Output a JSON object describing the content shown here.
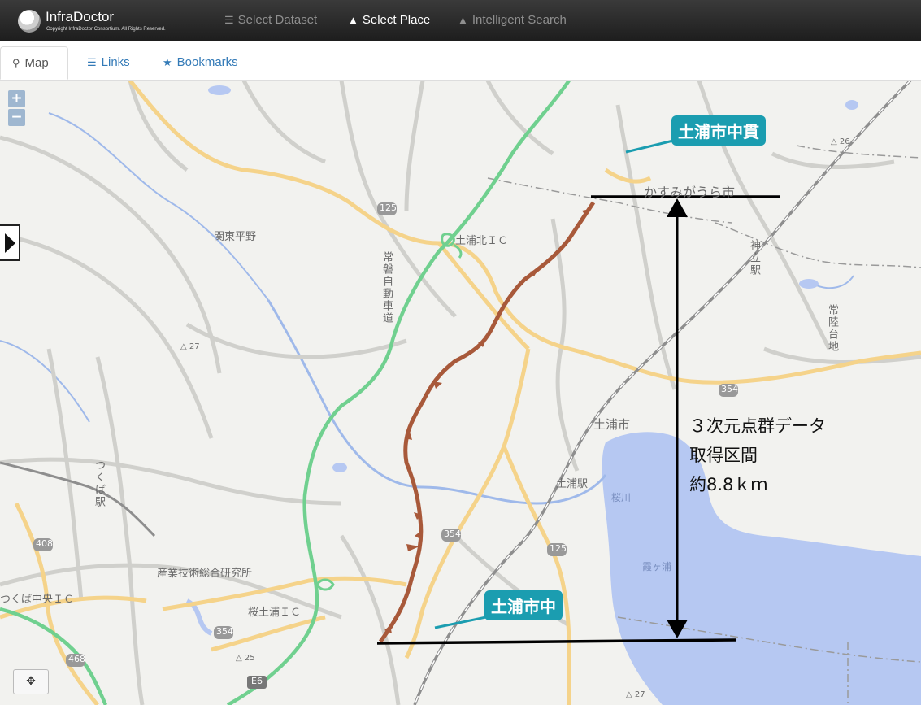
{
  "app": {
    "name": "InfraDoctor",
    "copyright": "Copyright InfraDoctor Consortium. All Rights Reserved."
  },
  "nav": [
    {
      "label": "Select Dataset",
      "icon": "table-icon",
      "active": false
    },
    {
      "label": "Select Place",
      "icon": "road-icon",
      "active": true
    },
    {
      "label": "Intelligent Search",
      "icon": "road-icon",
      "active": false
    }
  ],
  "tabs": [
    {
      "label": "Map",
      "icon": "map-marker-icon",
      "active": true
    },
    {
      "label": "Links",
      "icon": "list-icon",
      "active": false
    },
    {
      "label": "Bookmarks",
      "icon": "star-icon",
      "active": false
    }
  ],
  "map_controls": {
    "zoom_in": "+",
    "zoom_out": "−"
  },
  "map_labels": {
    "kasumigaura": "かすみがうら市",
    "kanto_heiya": "関東平野",
    "tsuchiura_kita_ic": "土浦北ＩＣ",
    "joban_expressway": "常磐自動車道",
    "kandatsu_station": "神立駅",
    "hitachi_daichi": "常陸台地",
    "tsuchiura_city": "土浦市",
    "tsuchiura_station": "土浦駅",
    "sakuragawa": "桜川",
    "kasumigaura_lake": "霞ヶ浦",
    "tsukuba_station": "つくば駅",
    "aist": "産業技術総合研究所",
    "tsukuba_chuo_ic": "つくば中央ＩＣ",
    "sakura_tsuchiura_ic": "桜土浦ＩＣ",
    "route_125_a": "125",
    "route_125_b": "125",
    "route_354_a": "354",
    "route_354_b": "354",
    "route_354_c": "354",
    "route_408": "408",
    "route_468": "468",
    "route_e6": "E6",
    "elev_27_a": "27",
    "elev_27_b": "27",
    "elev_25": "25",
    "elev_26": "26"
  },
  "annotations": {
    "callout_top": "土浦市中貫",
    "callout_bottom": "土浦市中",
    "section_line1": "３次元点群データ",
    "section_line2": "取得区間",
    "section_line3": "約8.8ｋｍ"
  },
  "colors": {
    "navbar": "#222222",
    "link": "#337ab7",
    "water": "#b6c8f2",
    "expressway": "#70d08f",
    "route_survey": "#a8593a",
    "callout": "#1b9db0",
    "national_road": "#f5d38a"
  }
}
